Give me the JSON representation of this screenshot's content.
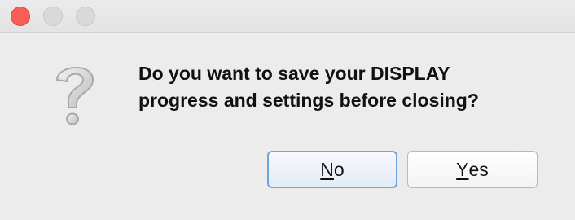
{
  "dialog": {
    "message_line1": "Do you want to save your DISPLAY",
    "message_line2": "progress and settings before closing?",
    "icon": "question-mark-icon"
  },
  "buttons": {
    "no": {
      "mnemonic": "N",
      "rest": "o"
    },
    "yes": {
      "mnemonic": "Y",
      "rest": "es"
    }
  },
  "colors": {
    "close_button": "#fc5f57",
    "default_button_border": "#6aa3e8"
  }
}
